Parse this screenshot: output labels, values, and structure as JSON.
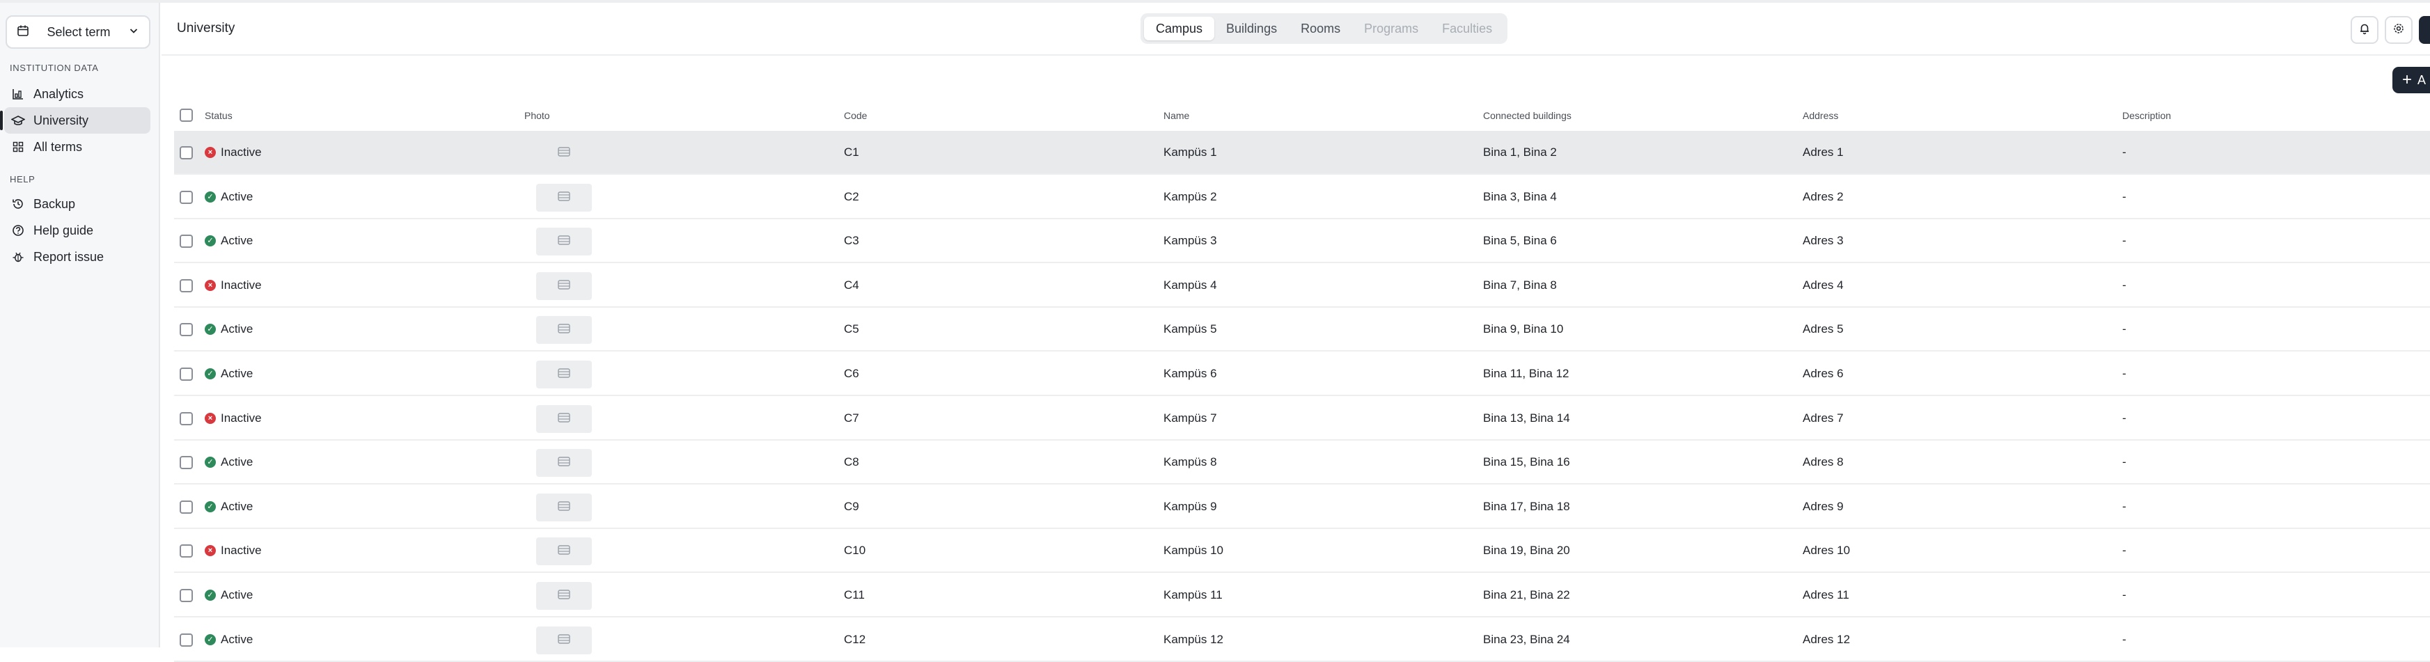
{
  "sidebar": {
    "term_select": {
      "label": "Select term"
    },
    "sections": [
      {
        "title": "INSTITUTION DATA",
        "items": [
          {
            "label": "Analytics",
            "icon": "chart-icon"
          },
          {
            "label": "University",
            "icon": "graduation-cap-icon",
            "active": true
          },
          {
            "label": "All terms",
            "icon": "grid-icon"
          }
        ]
      },
      {
        "title": "HELP",
        "items": [
          {
            "label": "Backup",
            "icon": "history-icon"
          },
          {
            "label": "Help guide",
            "icon": "help-circle-icon"
          },
          {
            "label": "Report issue",
            "icon": "bug-icon"
          }
        ]
      }
    ]
  },
  "header": {
    "title": "University",
    "tabs": [
      {
        "label": "Campus",
        "state": "selected"
      },
      {
        "label": "Buildings",
        "state": "normal"
      },
      {
        "label": "Rooms",
        "state": "normal"
      },
      {
        "label": "Programs",
        "state": "disabled"
      },
      {
        "label": "Faculties",
        "state": "disabled"
      }
    ]
  },
  "toolbar": {
    "add_label": "A"
  },
  "table": {
    "columns": [
      "Status",
      "Photo",
      "Code",
      "Name",
      "Connected buildings",
      "Address",
      "Description"
    ],
    "rows": [
      {
        "status": "Inactive",
        "code": "C1",
        "name": "Kampüs 1",
        "buildings": "Bina 1, Bina 2",
        "address": "Adres 1",
        "description": "-"
      },
      {
        "status": "Active",
        "code": "C2",
        "name": "Kampüs 2",
        "buildings": "Bina 3, Bina 4",
        "address": "Adres 2",
        "description": "-"
      },
      {
        "status": "Active",
        "code": "C3",
        "name": "Kampüs 3",
        "buildings": "Bina 5, Bina 6",
        "address": "Adres 3",
        "description": "-"
      },
      {
        "status": "Inactive",
        "code": "C4",
        "name": "Kampüs 4",
        "buildings": "Bina 7, Bina 8",
        "address": "Adres 4",
        "description": "-"
      },
      {
        "status": "Active",
        "code": "C5",
        "name": "Kampüs 5",
        "buildings": "Bina 9, Bina 10",
        "address": "Adres 5",
        "description": "-"
      },
      {
        "status": "Active",
        "code": "C6",
        "name": "Kampüs 6",
        "buildings": "Bina 11, Bina 12",
        "address": "Adres 6",
        "description": "-"
      },
      {
        "status": "Inactive",
        "code": "C7",
        "name": "Kampüs 7",
        "buildings": "Bina 13, Bina 14",
        "address": "Adres 7",
        "description": "-"
      },
      {
        "status": "Active",
        "code": "C8",
        "name": "Kampüs 8",
        "buildings": "Bina 15, Bina 16",
        "address": "Adres 8",
        "description": "-"
      },
      {
        "status": "Active",
        "code": "C9",
        "name": "Kampüs 9",
        "buildings": "Bina 17, Bina 18",
        "address": "Adres 9",
        "description": "-"
      },
      {
        "status": "Inactive",
        "code": "C10",
        "name": "Kampüs 10",
        "buildings": "Bina 19, Bina 20",
        "address": "Adres 10",
        "description": "-"
      },
      {
        "status": "Active",
        "code": "C11",
        "name": "Kampüs 11",
        "buildings": "Bina 21, Bina 22",
        "address": "Adres 11",
        "description": "-"
      },
      {
        "status": "Active",
        "code": "C12",
        "name": "Kampüs 12",
        "buildings": "Bina 23, Bina 24",
        "address": "Adres 12",
        "description": "-"
      }
    ]
  },
  "colors": {
    "active": "#2f8a5b",
    "inactive": "#d8393e",
    "primary": "#1e2533",
    "highlight_row": "#e9eaec"
  }
}
